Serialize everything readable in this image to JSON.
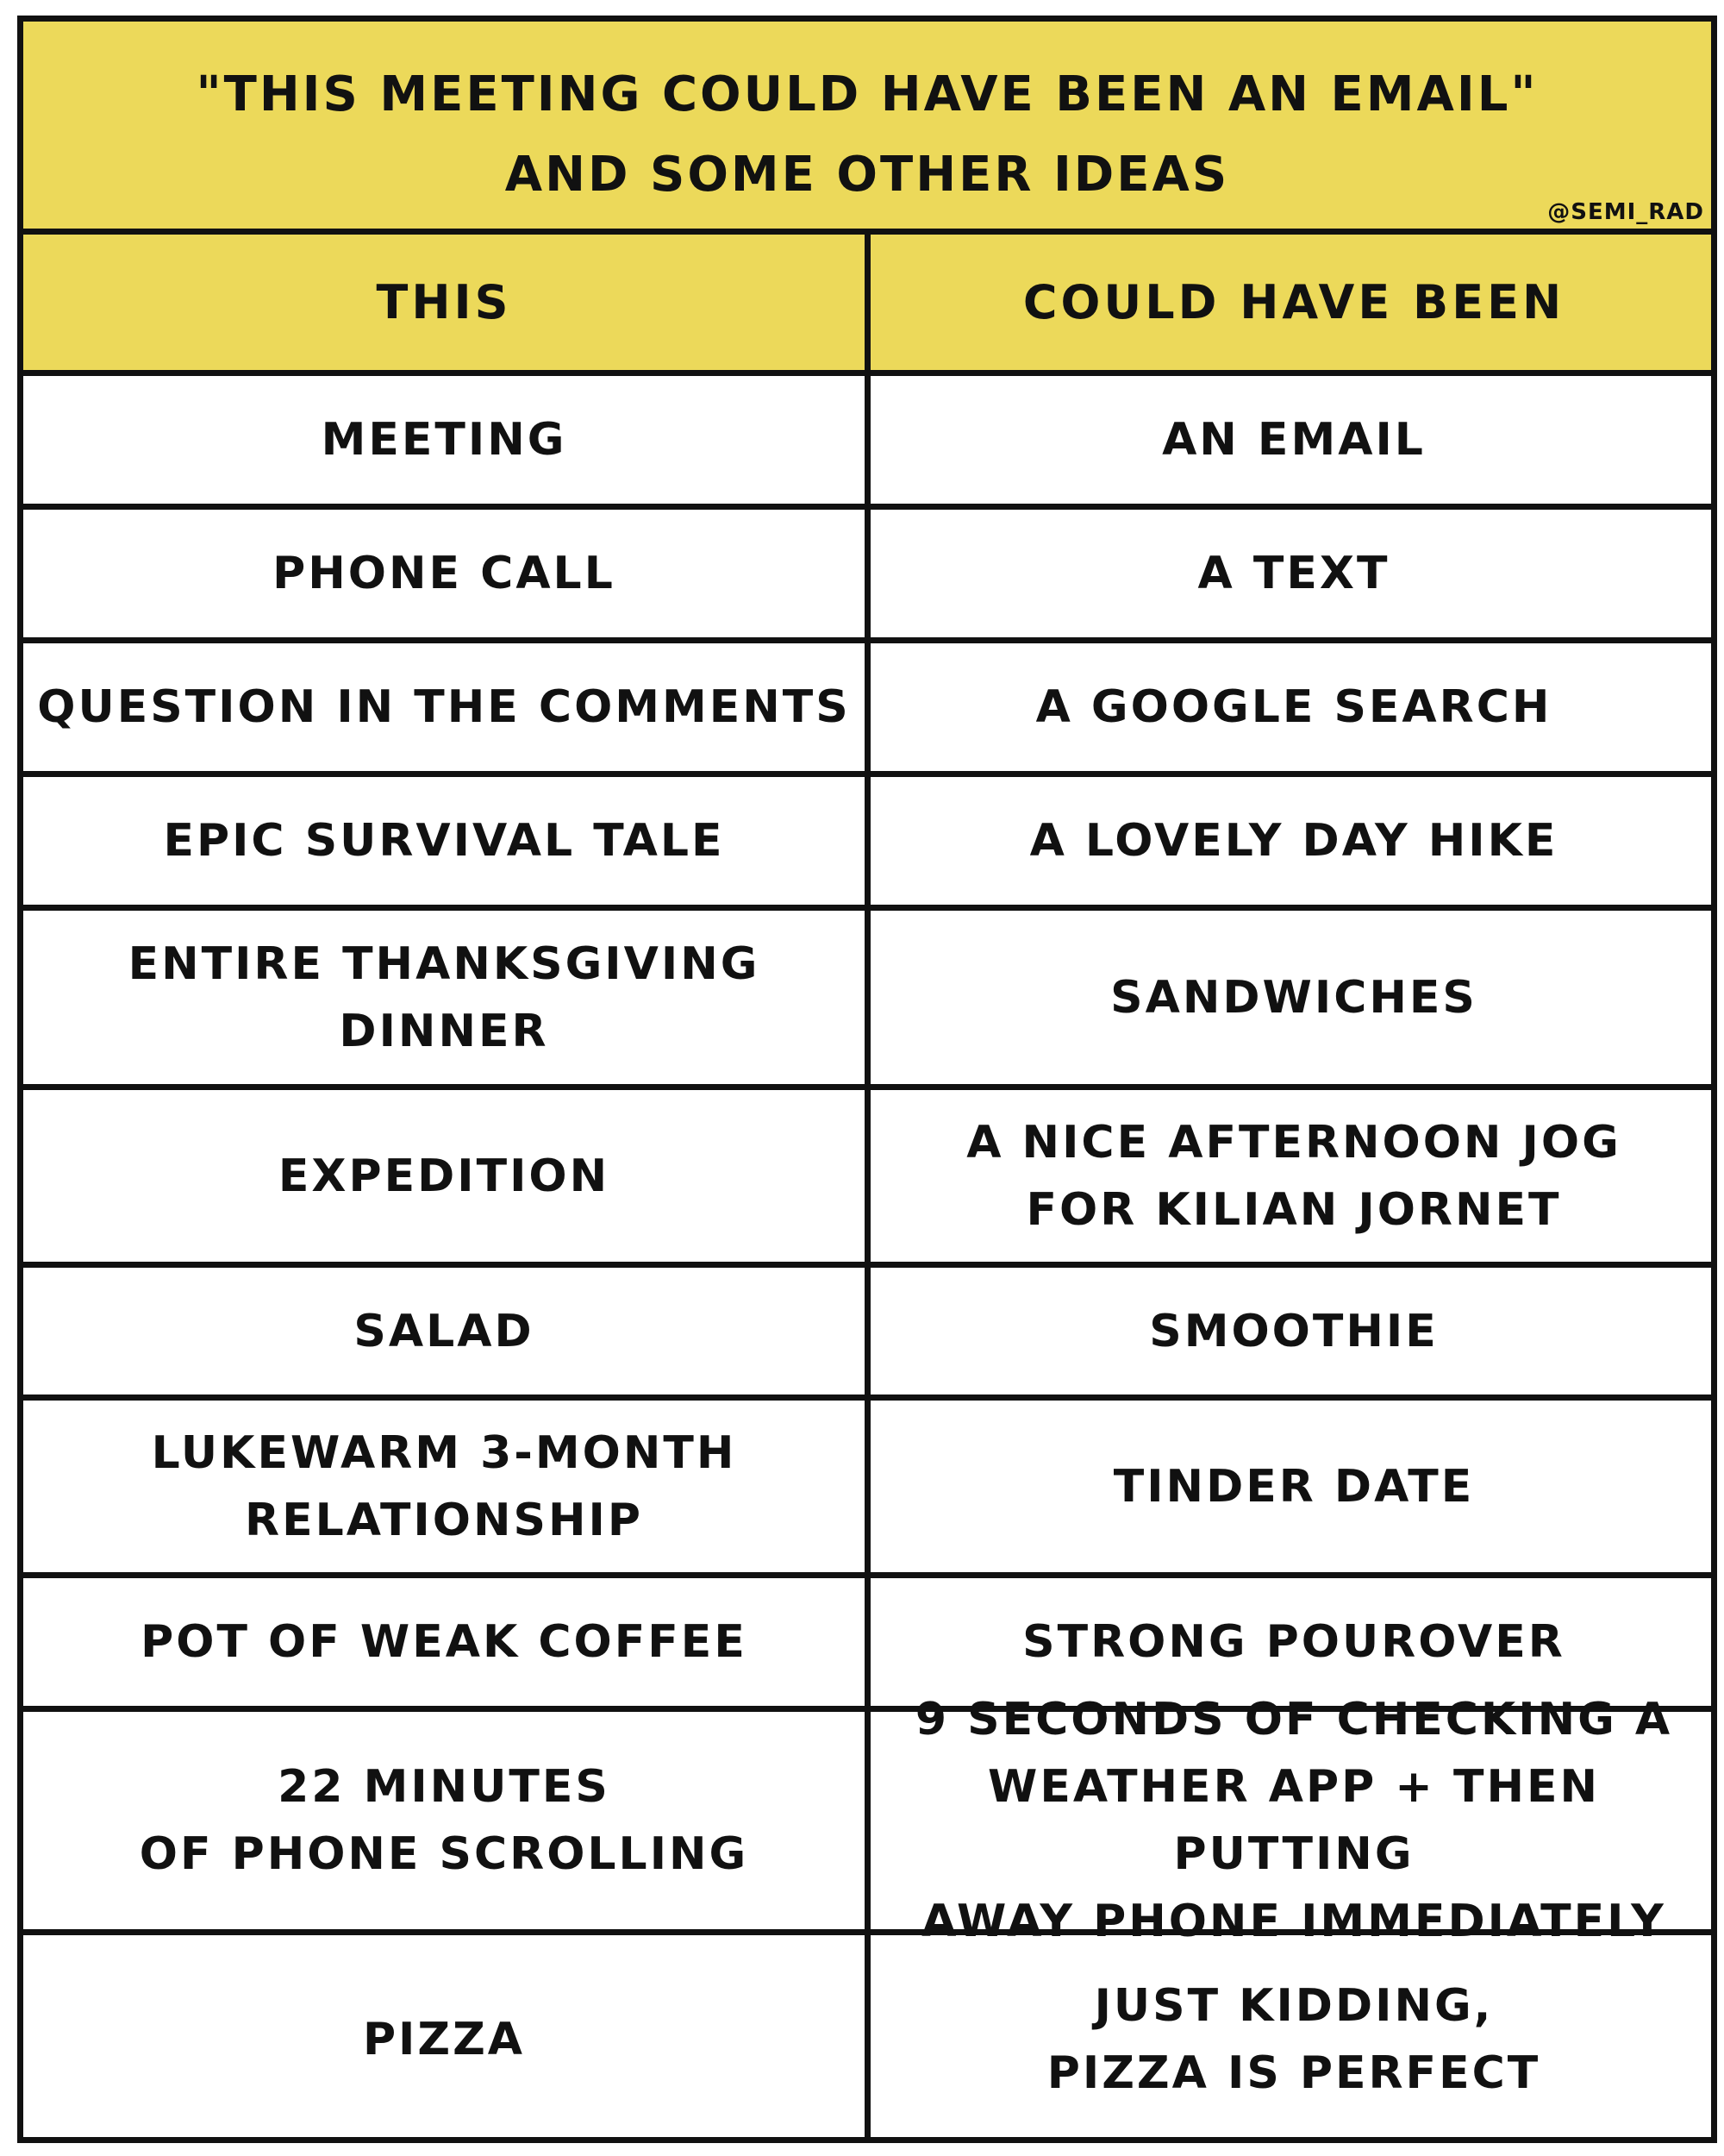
{
  "colors": {
    "accent": "#ecd95a",
    "ink": "#111111",
    "cell_bg": "#ffffff"
  },
  "title": {
    "line1": "\"THIS MEETING COULD HAVE BEEN AN EMAIL\"",
    "line2": "AND SOME OTHER IDEAS",
    "credit": "@SEMI_RAD"
  },
  "table": {
    "headers": {
      "left": "THIS",
      "right": "COULD HAVE BEEN"
    },
    "rows": [
      {
        "this": "MEETING",
        "could_have_been": "AN EMAIL"
      },
      {
        "this": "PHONE CALL",
        "could_have_been": "A TEXT"
      },
      {
        "this": "QUESTION IN THE COMMENTS",
        "could_have_been": "A GOOGLE SEARCH"
      },
      {
        "this": "EPIC SURVIVAL TALE",
        "could_have_been": "A LOVELY DAY HIKE"
      },
      {
        "this": "ENTIRE THANKSGIVING\nDINNER",
        "could_have_been": "SANDWICHES"
      },
      {
        "this": "EXPEDITION",
        "could_have_been": "A NICE AFTERNOON JOG\nFOR KILIAN JORNET"
      },
      {
        "this": "SALAD",
        "could_have_been": "SMOOTHIE"
      },
      {
        "this": "LUKEWARM 3-MONTH\nRELATIONSHIP",
        "could_have_been": "TINDER DATE"
      },
      {
        "this": "POT OF WEAK COFFEE",
        "could_have_been": "STRONG POUROVER"
      },
      {
        "this": "22 MINUTES\nOF PHONE SCROLLING",
        "could_have_been": "9 SECONDS OF CHECKING A\nWEATHER APP + THEN PUTTING\nAWAY PHONE IMMEDIATELY"
      },
      {
        "this": "PIZZA",
        "could_have_been": "JUST KIDDING,\nPIZZA IS PERFECT"
      }
    ]
  }
}
